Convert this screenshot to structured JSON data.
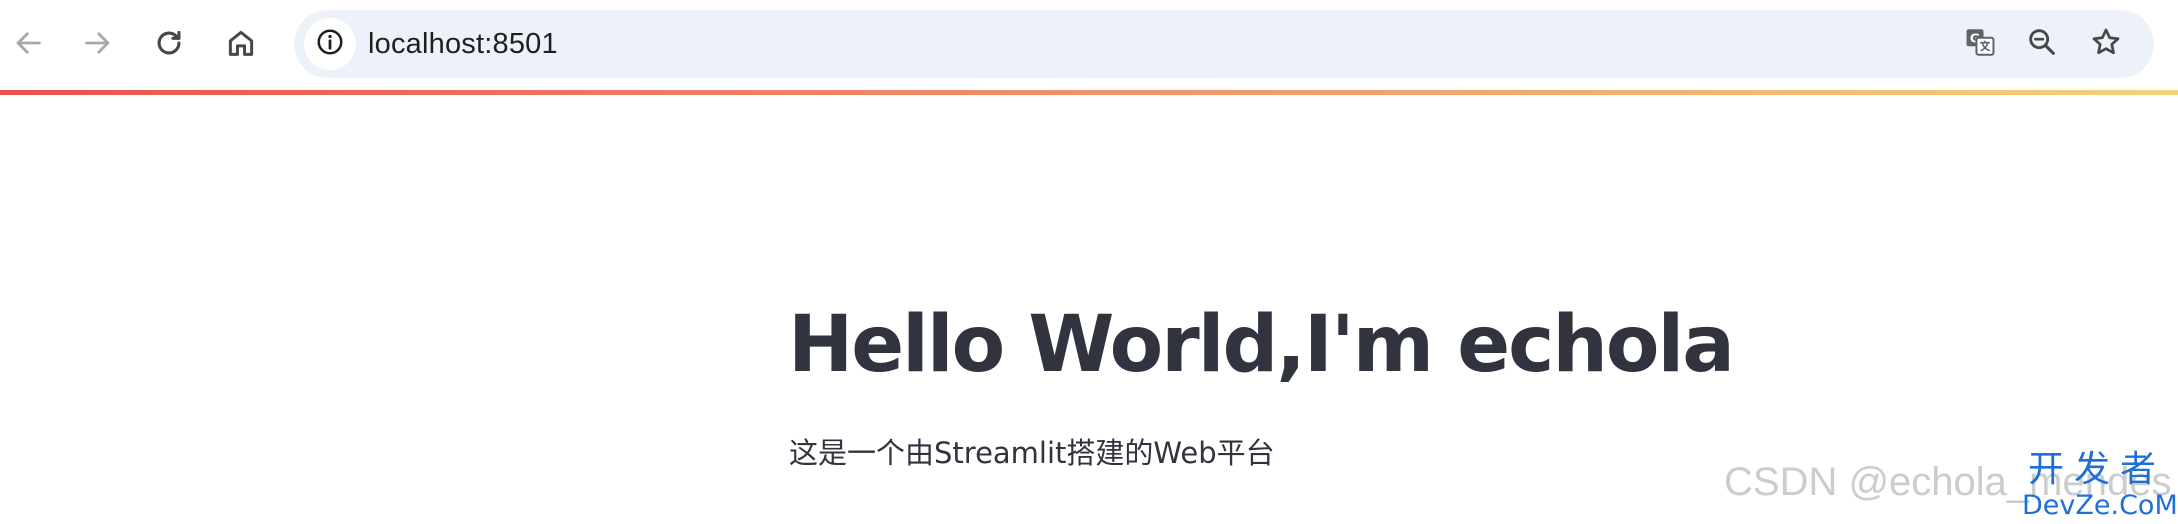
{
  "browser": {
    "address_bar": {
      "url": "localhost:8501"
    },
    "icons": {
      "back": "arrow-left-icon",
      "forward": "arrow-right-icon",
      "reload": "reload-icon",
      "home": "home-icon",
      "site_info": "info-icon",
      "translate": "translate-icon",
      "zoom": "zoom-out-icon",
      "bookmark": "star-icon"
    },
    "loading_bar_colors": [
      "#e8514d",
      "#f2a96d",
      "#f5d278"
    ]
  },
  "app": {
    "title": "Hello World,I'm echola",
    "subtitle": "这是一个由Streamlit搭建的Web平台",
    "text_color": "#31333f"
  },
  "watermarks": {
    "csdn": "CSDN @echola_mendes",
    "dev_top": "开发者",
    "dev_bottom": "DevZe.CoM"
  }
}
